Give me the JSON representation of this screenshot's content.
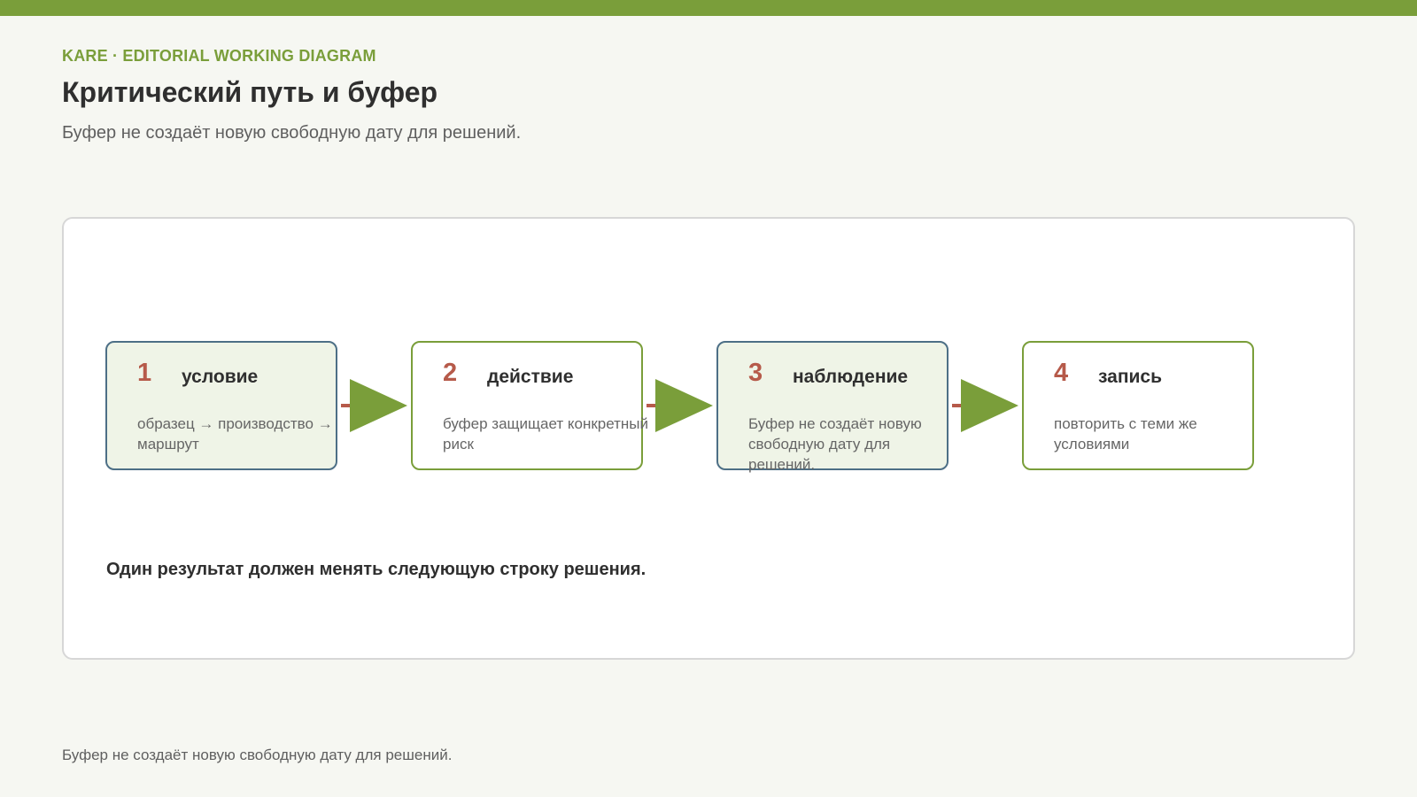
{
  "header": {
    "kicker": "KARE · EDITORIAL WORKING DIAGRAM",
    "title": "Критический путь и буфер",
    "subtitle": "Буфер не создаёт новую свободную дату для решений."
  },
  "flow": {
    "steps": [
      {
        "number": "1",
        "title": "условие",
        "text": "образец → производство → маршрут"
      },
      {
        "number": "2",
        "title": "действие",
        "text": "буфер защищает конкретный риск"
      },
      {
        "number": "3",
        "title": "наблюдение",
        "text": "Буфер не создаёт новую свободную дату для решений."
      },
      {
        "number": "4",
        "title": "запись",
        "text": "повторить с теми же условиями"
      }
    ],
    "conclusion": "Один результат должен менять следующую строку решения."
  },
  "footer": {
    "note": "Буфер не создаёт новую свободную дату для решений."
  },
  "colors": {
    "accent_green": "#7a9e3a",
    "step_number_red": "#b65a4a",
    "step_border_blue": "#4d6f86",
    "step_fill_green": "#eff4e7"
  }
}
